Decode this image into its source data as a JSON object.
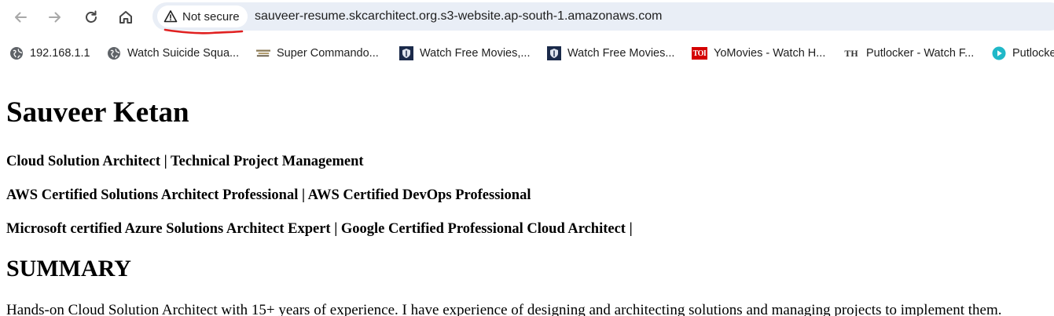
{
  "browser": {
    "security_label": "Not secure",
    "url": "sauveer-resume.skcarchitect.org.s3-website.ap-south-1.amazonaws.com",
    "buttons": {
      "back_icon": "arrow-left-icon",
      "forward_icon": "arrow-right-icon",
      "reload_icon": "reload-icon",
      "home_icon": "home-icon"
    },
    "annotation_color": "#e02020"
  },
  "bookmarks": [
    {
      "label": "192.168.1.1",
      "icon": "globe-icon"
    },
    {
      "label": "Watch Suicide Squa...",
      "icon": "globe-icon"
    },
    {
      "label": "Super Commando...",
      "icon": "site-logo-icon"
    },
    {
      "label": "Watch Free Movies,...",
      "icon": "shield-logo-icon"
    },
    {
      "label": "Watch Free Movies...",
      "icon": "shield-logo-icon"
    },
    {
      "label": "YoMovies - Watch H...",
      "icon": "toi-logo-icon",
      "icon_text": "TOI"
    },
    {
      "label": "Putlocker - Watch F...",
      "icon": "th-logo-icon",
      "icon_text": "TH"
    },
    {
      "label": "Putlocke",
      "icon": "play-circle-icon"
    }
  ],
  "page": {
    "name": "Sauveer Ketan",
    "headlines": [
      "Cloud Solution Architect | Technical Project Management",
      "AWS Certified Solutions Architect Professional | AWS Certified DevOps Professional",
      "Microsoft certified Azure Solutions Architect Expert | Google Certified Professional Cloud Architect |"
    ],
    "summary_title": "SUMMARY",
    "summary_text": "Hands-on Cloud Solution Architect with 15+ years of experience. I have experience of designing and architecting solutions and managing projects to implement them."
  }
}
